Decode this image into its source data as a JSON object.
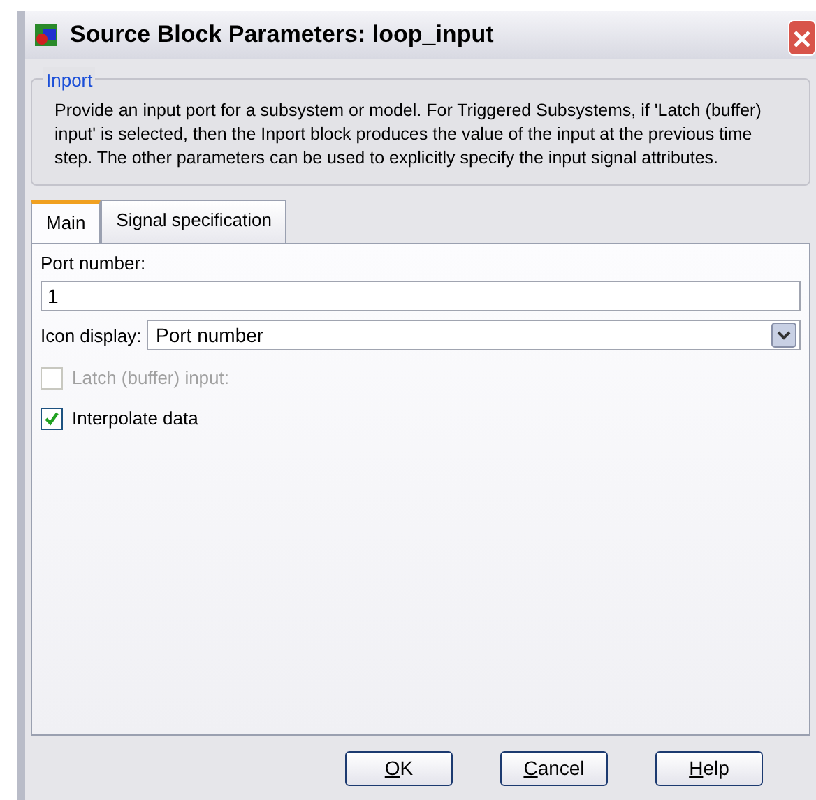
{
  "window": {
    "title": "Source Block Parameters: loop_input"
  },
  "group": {
    "title": "Inport",
    "description": "Provide an input port for a subsystem or model. For Triggered Subsystems, if 'Latch (buffer) input' is selected, then the Inport block produces the value of the input at the previous time step. The other parameters can be used to explicitly specify the input signal attributes."
  },
  "tabs": [
    {
      "label": "Main",
      "selected": true
    },
    {
      "label": "Signal specification",
      "selected": false
    }
  ],
  "port_number": {
    "label": "Port number:",
    "value": "1"
  },
  "icon_display": {
    "label": "Icon display:",
    "value": "Port number"
  },
  "checkboxes": [
    {
      "label": "Latch (buffer) input:",
      "checked": false,
      "disabled": true
    },
    {
      "label": "Interpolate data",
      "checked": true,
      "disabled": false
    }
  ],
  "buttons": [
    "OK",
    "Cancel",
    "Help"
  ]
}
